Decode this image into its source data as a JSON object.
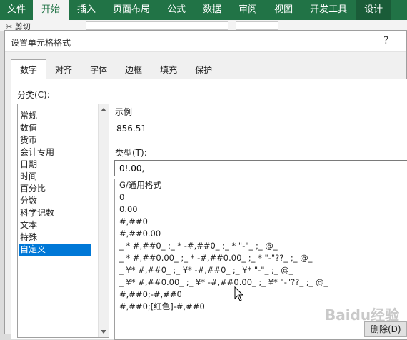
{
  "ribbon": {
    "tabs": [
      "文件",
      "开始",
      "插入",
      "页面布局",
      "公式",
      "数据",
      "审阅",
      "视图",
      "开发工具",
      "设计"
    ],
    "active_index": 1,
    "cut_label": "剪切"
  },
  "dialog": {
    "title": "设置单元格格式",
    "help": "?",
    "tabs": [
      "数字",
      "对齐",
      "字体",
      "边框",
      "填充",
      "保护"
    ],
    "active_tab": 0,
    "category_label": "分类(C):",
    "categories": [
      "常规",
      "数值",
      "货币",
      "会计专用",
      "日期",
      "时间",
      "百分比",
      "分数",
      "科学记数",
      "文本",
      "特殊",
      "自定义"
    ],
    "selected_category": 11,
    "sample_label": "示例",
    "sample_value": "856.51",
    "type_label": "类型(T):",
    "type_value": "0!.00,",
    "formats": [
      "G/通用格式",
      "0",
      "0.00",
      "#,##0",
      "#,##0.00",
      "_ * #,##0_ ;_ * -#,##0_ ;_ * \"-\"_ ;_ @_",
      "_ * #,##0.00_ ;_ * -#,##0.00_ ;_ * \"-\"??_ ;_ @_",
      "_ ¥* #,##0_ ;_ ¥* -#,##0_ ;_ ¥* \"-\"_ ;_ @_",
      "_ ¥* #,##0.00_ ;_ ¥* -#,##0.00_ ;_ ¥* \"-\"??_ ;_ @_",
      "#,##0;-#,##0",
      "#,##0;[红色]-#,##0"
    ],
    "delete_label": "删除(D)"
  },
  "colors": {
    "ribbon": "#217346",
    "selection": "#0078d7"
  },
  "watermark": "Baidu经验"
}
